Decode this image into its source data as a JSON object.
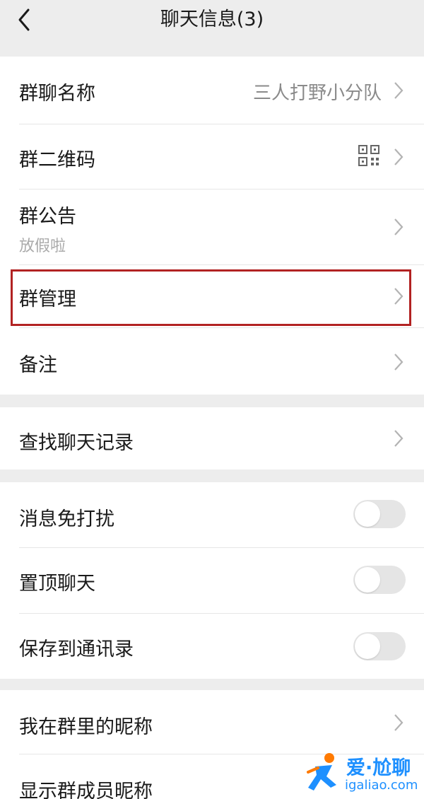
{
  "navbar": {
    "title": "聊天信息(3)"
  },
  "group_section": {
    "name_label": "群聊名称",
    "name_value": "三人打野小分队",
    "qr_label": "群二维码",
    "notice_label": "群公告",
    "notice_text": "放假啦",
    "manage_label": "群管理",
    "remark_label": "备注"
  },
  "search_section": {
    "search_label": "查找聊天记录"
  },
  "toggle_section": {
    "mute_label": "消息免打扰",
    "mute_on": false,
    "pin_label": "置顶聊天",
    "pin_on": false,
    "save_label": "保存到通讯录",
    "save_on": false
  },
  "nickname_section": {
    "my_nickname_label": "我在群里的昵称",
    "show_nickname_label": "显示群成员昵称"
  },
  "watermark": {
    "brand": "爱·尬聊",
    "site": "igaliao.com"
  },
  "colors": {
    "highlight_border": "#b22222",
    "toggle_off": "#e5e5e5",
    "background": "#ededed"
  }
}
